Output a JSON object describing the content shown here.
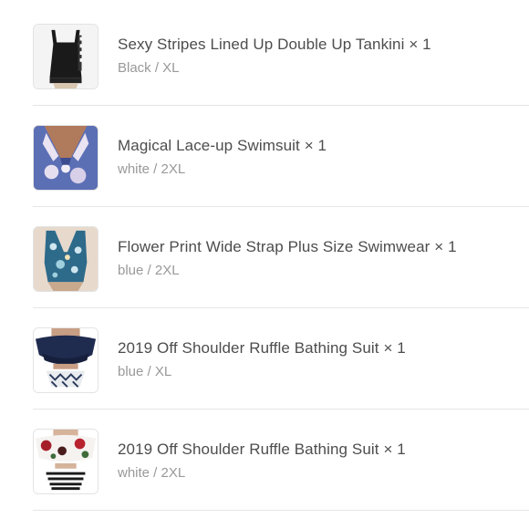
{
  "order_items": [
    {
      "name": "Sexy Stripes Lined Up Double Up Tankini",
      "quantity": "× 1",
      "variant": "Black / XL",
      "thumbnail": "black-tankini"
    },
    {
      "name": "Magical Lace-up Swimsuit",
      "quantity": "× 1",
      "variant": "white / 2XL",
      "thumbnail": "floral-lace-up-swimsuit"
    },
    {
      "name": "Flower Print Wide Strap Plus Size Swimwear",
      "quantity": "× 1",
      "variant": "blue / 2XL",
      "thumbnail": "blue-flower-swimwear"
    },
    {
      "name": "2019 Off Shoulder Ruffle Bathing Suit",
      "quantity": "× 1",
      "variant": "blue / XL",
      "thumbnail": "navy-ruffle-bikini"
    },
    {
      "name": "2019 Off Shoulder Ruffle Bathing Suit",
      "quantity": "× 1",
      "variant": "white / 2XL",
      "thumbnail": "white-floral-ruffle-bikini"
    }
  ]
}
